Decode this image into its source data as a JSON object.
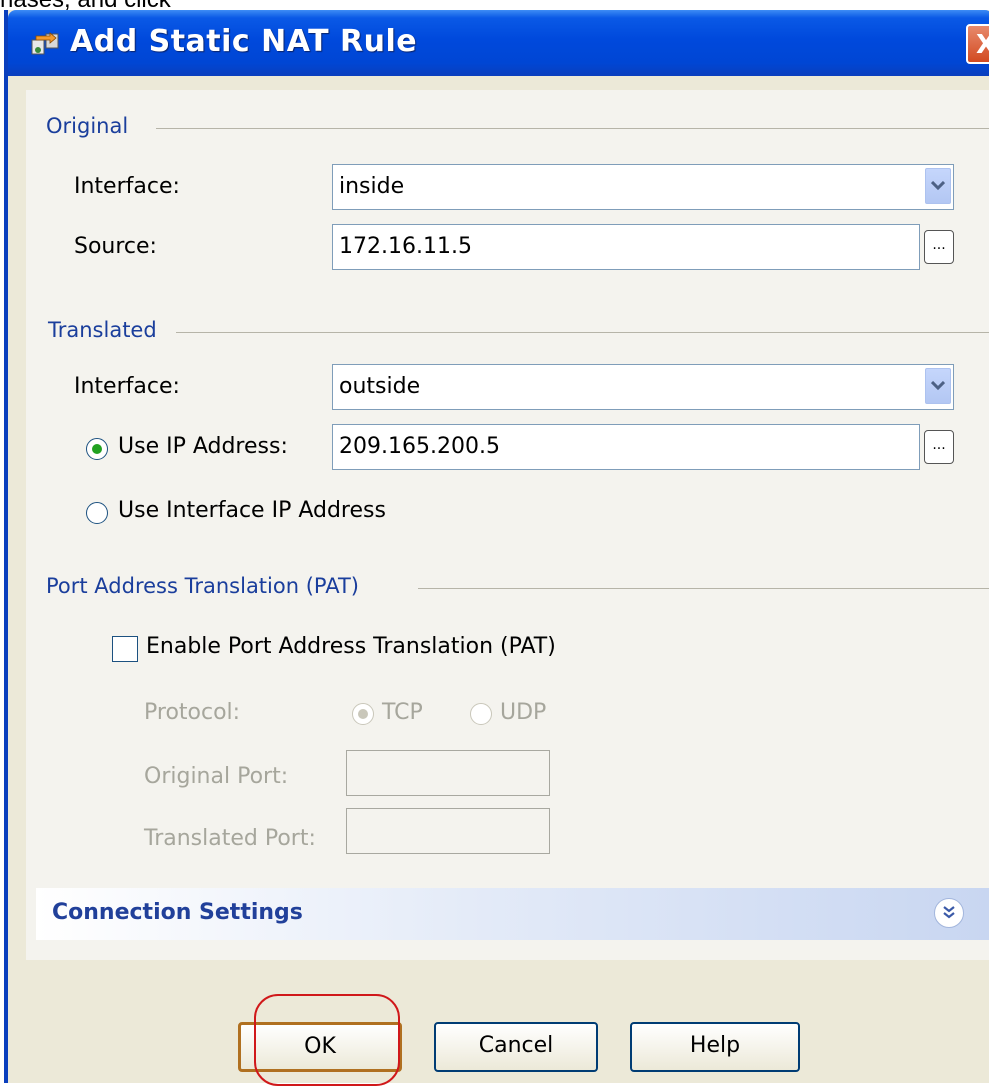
{
  "caption": "nases, and click",
  "window": {
    "title": "Add Static NAT Rule",
    "close_glyph": "X"
  },
  "original": {
    "group_label": "Original",
    "interface_label": "Interface:",
    "interface_value": "inside",
    "source_label": "Source:",
    "source_value": "172.16.11.5",
    "browse_label": "..."
  },
  "translated": {
    "group_label": "Translated",
    "interface_label": "Interface:",
    "interface_value": "outside",
    "use_ip_label": "Use IP Address:",
    "use_ip_value": "209.165.200.5",
    "use_ip_checked": true,
    "use_interface_label": "Use Interface IP Address",
    "use_interface_checked": false,
    "browse_label": "..."
  },
  "pat": {
    "group_label": "Port Address Translation (PAT)",
    "enable_label": "Enable Port Address Translation (PAT)",
    "enable_checked": false,
    "protocol_label": "Protocol:",
    "tcp_label": "TCP",
    "udp_label": "UDP",
    "original_port_label": "Original Port:",
    "original_port_value": "",
    "translated_port_label": "Translated Port:",
    "translated_port_value": ""
  },
  "connection_settings": {
    "label": "Connection Settings"
  },
  "buttons": {
    "ok": "OK",
    "cancel": "Cancel",
    "help": "Help"
  },
  "icons": {
    "title": "nat-rule-icon",
    "dropdown": "chevron-down-icon",
    "expand": "double-chevron-down-icon"
  },
  "colors": {
    "title_bar": "#0049dc",
    "group_label": "#1a3e9c",
    "highlight_circle": "#d0181a",
    "radio_checked": "#21a121"
  }
}
